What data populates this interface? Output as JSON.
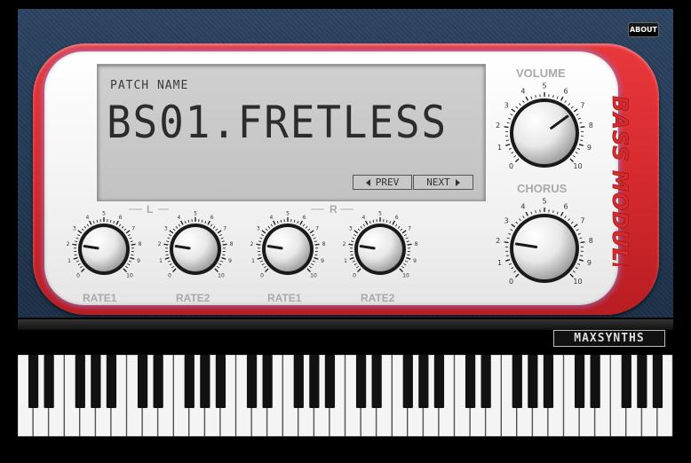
{
  "header": {
    "about_label": "ABOUT"
  },
  "display": {
    "patch_label": "PATCH NAME",
    "patch_name": "BS01.FRETLESS",
    "prev_label": "PREV",
    "next_label": "NEXT"
  },
  "knobs": {
    "volume": {
      "label": "VOLUME",
      "value": 7
    },
    "chorus": {
      "label": "CHORUS",
      "value": 2
    },
    "l_rate1": {
      "label": "RATE1",
      "value": 2
    },
    "l_rate2": {
      "label": "RATE2",
      "value": 2
    },
    "r_rate1": {
      "label": "RATE1",
      "value": 2
    },
    "r_rate2": {
      "label": "RATE2",
      "value": 2
    }
  },
  "groups": {
    "left": "L",
    "right": "R"
  },
  "scale_numbers": [
    "0",
    "1",
    "2",
    "3",
    "4",
    "5",
    "6",
    "7",
    "8",
    "9",
    "10"
  ],
  "brand": {
    "module": "BASS MODULE",
    "company": "MAXSYNTHS"
  },
  "keyboard": {
    "white_keys": 42
  },
  "colors": {
    "accent_red": "#d52a2e",
    "panel_blue": "#233954",
    "lcd": "#c8c8c8"
  }
}
